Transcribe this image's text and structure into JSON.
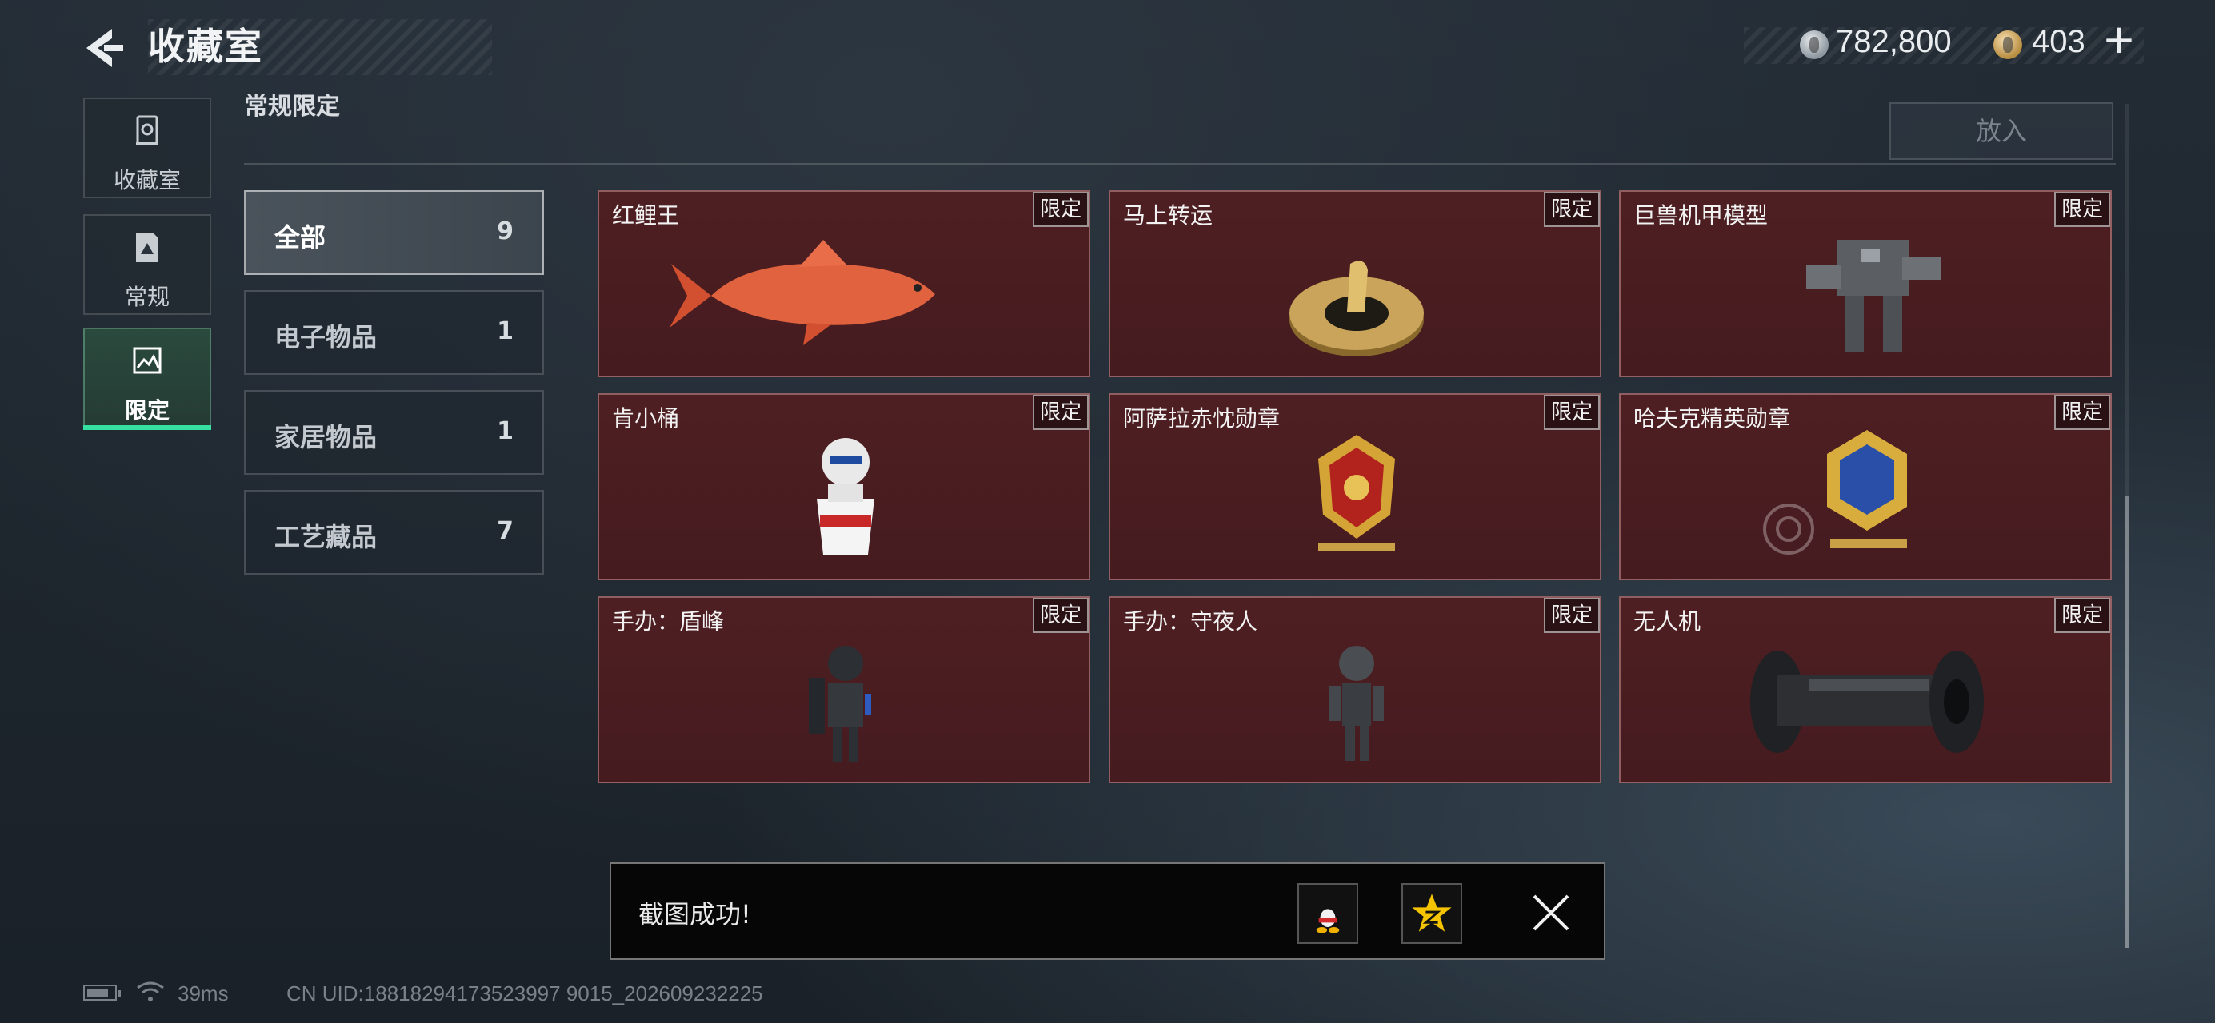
{
  "header": {
    "title": "收藏室",
    "currency_silver": "782,800",
    "currency_gold": "403",
    "plus": "+"
  },
  "nav": [
    {
      "label": "收藏室",
      "icon": "vault-icon"
    },
    {
      "label": "常规",
      "icon": "document-icon"
    },
    {
      "label": "限定",
      "icon": "image-icon"
    }
  ],
  "section": {
    "title": "常规限定",
    "put_button": "放入"
  },
  "categories": [
    {
      "name": "全部",
      "count": "9"
    },
    {
      "name": "电子物品",
      "count": "1"
    },
    {
      "name": "家居物品",
      "count": "1"
    },
    {
      "name": "工艺藏品",
      "count": "7"
    }
  ],
  "badge": "限定",
  "items": [
    {
      "name": "红鲤王",
      "icon": "red-carp-icon"
    },
    {
      "name": "马上转运",
      "icon": "golden-horse-coin-icon"
    },
    {
      "name": "巨兽机甲模型",
      "icon": "mech-model-icon"
    },
    {
      "name": "肯小桶",
      "icon": "kfc-bucket-figure-icon"
    },
    {
      "name": "阿萨拉赤忱勋章",
      "icon": "red-medal-icon"
    },
    {
      "name": "哈夫克精英勋章",
      "icon": "blue-medal-icon"
    },
    {
      "name": "手办：盾峰",
      "icon": "shield-soldier-figure-icon"
    },
    {
      "name": "手办：守夜人",
      "icon": "night-watcher-figure-icon"
    },
    {
      "name": "无人机",
      "icon": "drone-icon"
    }
  ],
  "toast": {
    "message": "截图成功!"
  },
  "status": {
    "ping": "39ms",
    "uid": "CN UID:18818294173523997 9015_202609232225"
  },
  "colors": {
    "card_bg": "#4e1f22",
    "active_tab": "#35e0a0",
    "toast_bg": "#060606"
  }
}
